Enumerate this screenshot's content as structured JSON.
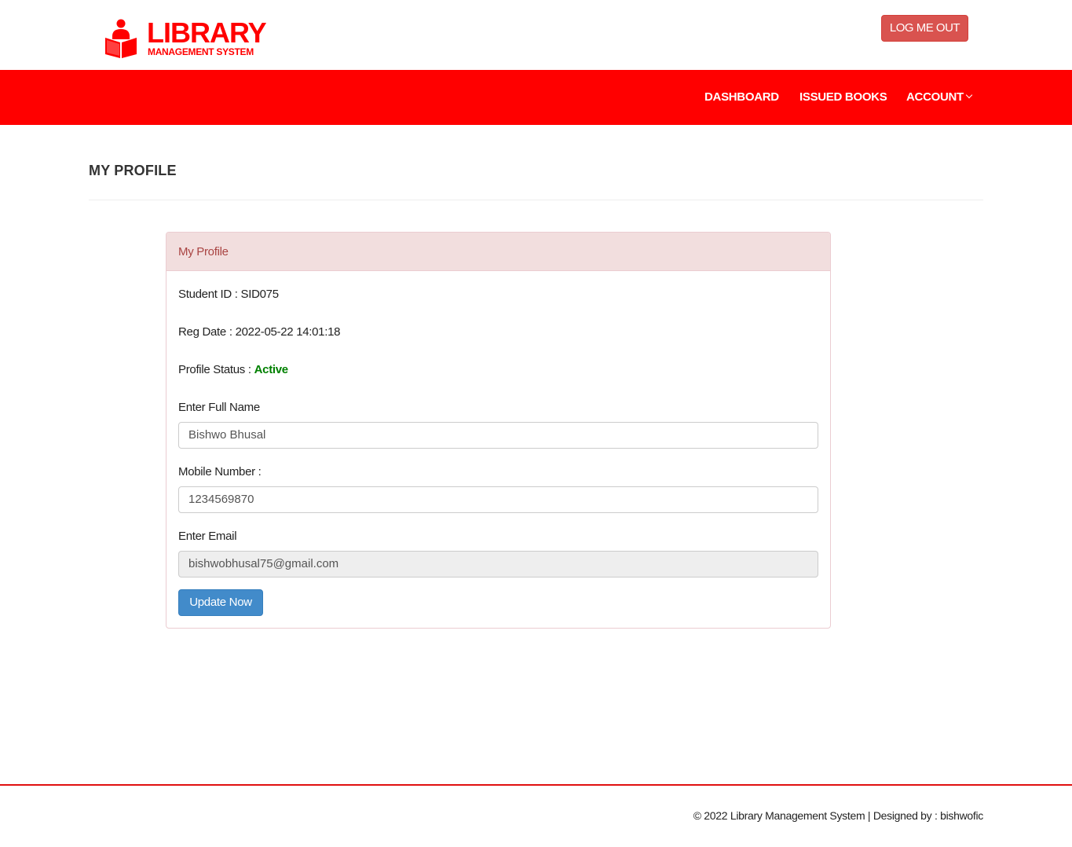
{
  "brand": {
    "title": "LIBRARY",
    "subtitle": "MANAGEMENT SYSTEM",
    "icon": "reader-book-icon",
    "color": "#ff0000"
  },
  "header": {
    "logout_label": "LOG ME OUT"
  },
  "nav": {
    "items": [
      {
        "label": "DASHBOARD"
      },
      {
        "label": "ISSUED BOOKS"
      },
      {
        "label": "ACCOUNT",
        "icon": "chevron-down-icon"
      }
    ],
    "background": "#ff0000"
  },
  "page": {
    "title": "MY PROFILE"
  },
  "panel": {
    "heading": "My Profile",
    "student_id_label": "Student ID :",
    "student_id": "SID075",
    "reg_date_label": "Reg Date :",
    "reg_date": "2022-05-22 14:01:18",
    "status_label": "Profile Status :",
    "status": "Active",
    "status_color": "#008000"
  },
  "form": {
    "full_name_label": "Enter Full Name",
    "full_name": "Bishwo Bhusal",
    "mobile_label": "Mobile Number :",
    "mobile": "1234569870",
    "email_label": "Enter Email",
    "email": "bishwobhusal75@gmail.com",
    "submit_label": "Update Now"
  },
  "footer": {
    "text": "© 2022 Library Management System | Designed by : bishwofic"
  }
}
